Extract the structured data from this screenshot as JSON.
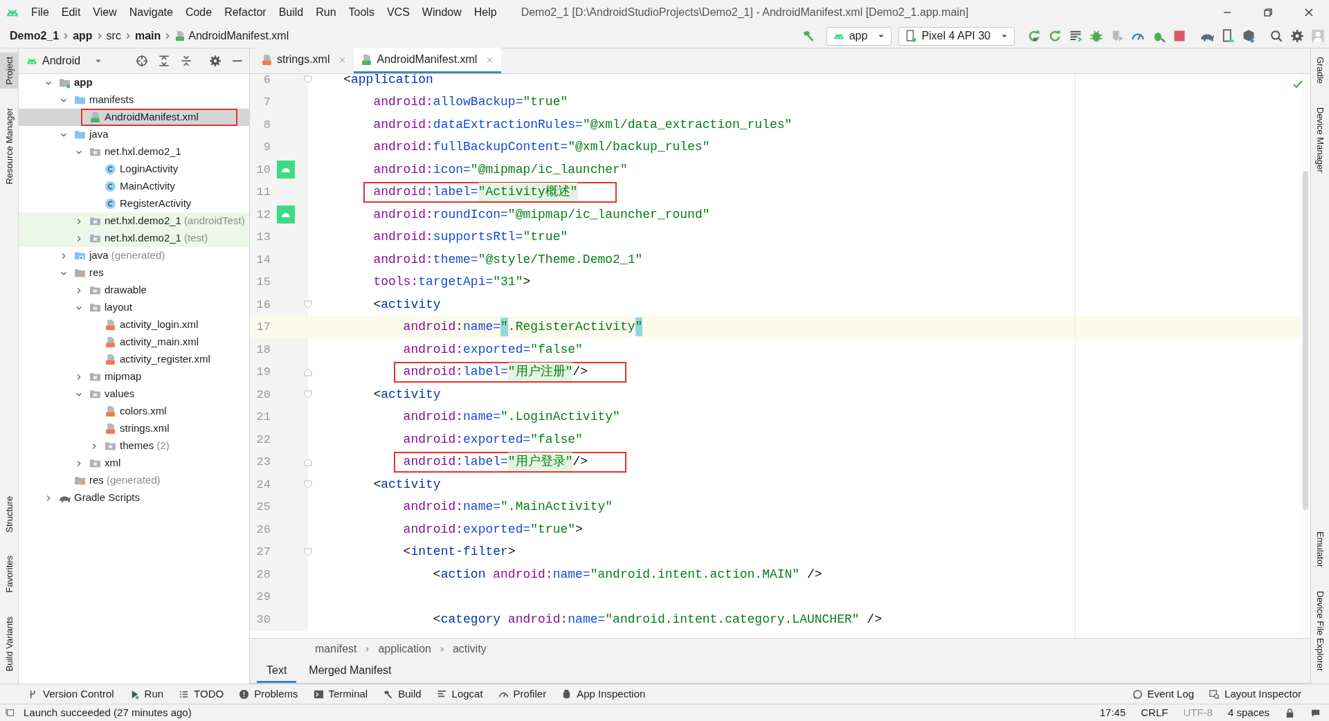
{
  "menu": [
    "File",
    "Edit",
    "View",
    "Navigate",
    "Code",
    "Refactor",
    "Build",
    "Run",
    "Tools",
    "VCS",
    "Window",
    "Help"
  ],
  "window_title": "Demo2_1 [D:\\AndroidStudioProjects\\Demo2_1] - AndroidManifest.xml [Demo2_1.app.main]",
  "breadcrumb": [
    {
      "text": "Demo2_1",
      "bold": true
    },
    {
      "text": "app",
      "bold": true
    },
    {
      "text": "src",
      "bold": false
    },
    {
      "text": "main",
      "bold": true
    },
    {
      "text": "AndroidManifest.xml",
      "bold": false
    }
  ],
  "run_config": "app",
  "device": "Pixel 4 API 30",
  "left_stripe": {
    "top": [
      {
        "label": "Project",
        "selected": true
      },
      {
        "label": "Resource Manager",
        "selected": false
      }
    ],
    "bottom": [
      {
        "label": "Structure",
        "selected": false
      },
      {
        "label": "Favorites",
        "selected": false
      },
      {
        "label": "Build Variants",
        "selected": false
      }
    ]
  },
  "right_stripe": {
    "top": [
      {
        "label": "Gradle",
        "selected": false
      },
      {
        "label": "Device Manager",
        "selected": false
      }
    ],
    "bottom": [
      {
        "label": "Emulator",
        "selected": false
      },
      {
        "label": "Device File Explorer",
        "selected": false
      }
    ]
  },
  "project_panel": {
    "view": "Android",
    "tree": [
      {
        "label": "app",
        "kind": "module",
        "bold": true,
        "selected": false,
        "highlighted": false,
        "boxed": false,
        "expanded": true,
        "children": [
          {
            "label": "manifests",
            "kind": "folder",
            "bold": false,
            "selected": false,
            "highlighted": false,
            "boxed": false,
            "expanded": true,
            "children": [
              {
                "label": "AndroidManifest.xml",
                "kind": "manifest",
                "bold": false,
                "selected": true,
                "highlighted": false,
                "boxed": true
              }
            ]
          },
          {
            "label": "java",
            "kind": "folder",
            "bold": false,
            "selected": false,
            "highlighted": false,
            "boxed": false,
            "expanded": true,
            "children": [
              {
                "label": "net.hxl.demo2_1",
                "kind": "package",
                "bold": false,
                "selected": false,
                "highlighted": false,
                "boxed": false,
                "expanded": true,
                "children": [
                  {
                    "label": "LoginActivity",
                    "kind": "class",
                    "bold": false,
                    "selected": false,
                    "highlighted": false,
                    "boxed": false
                  },
                  {
                    "label": "MainActivity",
                    "kind": "class",
                    "bold": false,
                    "selected": false,
                    "highlighted": false,
                    "boxed": false
                  },
                  {
                    "label": "RegisterActivity",
                    "kind": "class",
                    "bold": false,
                    "selected": false,
                    "highlighted": false,
                    "boxed": false
                  }
                ]
              },
              {
                "label": "net.hxl.demo2_1",
                "suffix": "(androidTest)",
                "kind": "package",
                "bold": false,
                "selected": false,
                "highlighted": true,
                "boxed": false,
                "expanded": false
              },
              {
                "label": "net.hxl.demo2_1",
                "suffix": "(test)",
                "kind": "package",
                "bold": false,
                "selected": false,
                "highlighted": true,
                "boxed": false,
                "expanded": false
              }
            ]
          },
          {
            "label": "java",
            "suffix": "(generated)",
            "kind": "generated",
            "bold": false,
            "selected": false,
            "highlighted": false,
            "boxed": false,
            "expanded": false
          },
          {
            "label": "res",
            "kind": "res",
            "bold": false,
            "selected": false,
            "highlighted": false,
            "boxed": false,
            "expanded": true,
            "children": [
              {
                "label": "drawable",
                "kind": "package",
                "bold": false,
                "selected": false,
                "highlighted": false,
                "boxed": false,
                "expanded": false
              },
              {
                "label": "layout",
                "kind": "package",
                "bold": false,
                "selected": false,
                "highlighted": false,
                "boxed": false,
                "expanded": true,
                "children": [
                  {
                    "label": "activity_login.xml",
                    "kind": "xml",
                    "bold": false,
                    "selected": false,
                    "highlighted": false,
                    "boxed": false
                  },
                  {
                    "label": "activity_main.xml",
                    "kind": "xml",
                    "bold": false,
                    "selected": false,
                    "highlighted": false,
                    "boxed": false
                  },
                  {
                    "label": "activity_register.xml",
                    "kind": "xml",
                    "bold": false,
                    "selected": false,
                    "highlighted": false,
                    "boxed": false
                  }
                ]
              },
              {
                "label": "mipmap",
                "kind": "package",
                "bold": false,
                "selected": false,
                "highlighted": false,
                "boxed": false,
                "expanded": false
              },
              {
                "label": "values",
                "kind": "package",
                "bold": false,
                "selected": false,
                "highlighted": false,
                "boxed": false,
                "expanded": true,
                "children": [
                  {
                    "label": "colors.xml",
                    "kind": "xml",
                    "bold": false,
                    "selected": false,
                    "highlighted": false,
                    "boxed": false
                  },
                  {
                    "label": "strings.xml",
                    "kind": "xml",
                    "bold": false,
                    "selected": false,
                    "highlighted": false,
                    "boxed": false
                  },
                  {
                    "label": "themes",
                    "suffix": "(2)",
                    "kind": "package",
                    "bold": false,
                    "selected": false,
                    "highlighted": false,
                    "boxed": false,
                    "expanded": false
                  }
                ]
              },
              {
                "label": "xml",
                "kind": "package",
                "bold": false,
                "selected": false,
                "highlighted": false,
                "boxed": false,
                "expanded": false
              }
            ]
          },
          {
            "label": "res",
            "suffix": "(generated)",
            "kind": "res",
            "bold": false,
            "selected": false,
            "highlighted": false,
            "boxed": false
          }
        ]
      },
      {
        "label": "Gradle Scripts",
        "kind": "gradle",
        "bold": false,
        "selected": false,
        "highlighted": false,
        "boxed": false,
        "expanded": false
      }
    ]
  },
  "editor_tabs": [
    {
      "label": "strings.xml",
      "kind": "xml",
      "selected": false
    },
    {
      "label": "AndroidManifest.xml",
      "kind": "manifest",
      "selected": true
    }
  ],
  "code_lines": [
    {
      "number": "6",
      "current": false,
      "boxed": false,
      "gutter_icon": false,
      "parts": [
        {
          "kind": "punct",
          "text": "<"
        },
        {
          "kind": "tag",
          "text": "application"
        }
      ],
      "children": [
        {
          "number": "7",
          "current": false,
          "boxed": false,
          "gutter_icon": false,
          "parts": [
            {
              "kind": "ns",
              "text": "android:"
            },
            {
              "kind": "attr",
              "text": "allowBackup="
            },
            {
              "kind": "value",
              "text": "\"true\""
            }
          ]
        },
        {
          "number": "8",
          "current": false,
          "boxed": false,
          "gutter_icon": false,
          "parts": [
            {
              "kind": "ns",
              "text": "android:"
            },
            {
              "kind": "attr",
              "text": "dataExtractionRules="
            },
            {
              "kind": "value",
              "text": "\"@xml/data_extraction_rules\""
            }
          ]
        },
        {
          "number": "9",
          "current": false,
          "boxed": false,
          "gutter_icon": false,
          "parts": [
            {
              "kind": "ns",
              "text": "android:"
            },
            {
              "kind": "attr",
              "text": "fullBackupContent="
            },
            {
              "kind": "value",
              "text": "\"@xml/backup_rules\""
            }
          ]
        },
        {
          "number": "10",
          "current": false,
          "boxed": false,
          "gutter_icon": true,
          "parts": [
            {
              "kind": "ns",
              "text": "android:"
            },
            {
              "kind": "attr",
              "text": "icon="
            },
            {
              "kind": "value",
              "text": "\"@mipmap/ic_launcher\""
            }
          ]
        },
        {
          "number": "11",
          "current": false,
          "boxed": true,
          "gutter_icon": false,
          "parts": [
            {
              "kind": "ns",
              "text": "android:"
            },
            {
              "kind": "attr",
              "text": "label="
            },
            {
              "kind": "value",
              "text": "\"Activity概述\"",
              "hl": true
            }
          ]
        },
        {
          "number": "12",
          "current": false,
          "boxed": false,
          "gutter_icon": true,
          "parts": [
            {
              "kind": "ns",
              "text": "android:"
            },
            {
              "kind": "attr",
              "text": "roundIcon="
            },
            {
              "kind": "value",
              "text": "\"@mipmap/ic_launcher_round\""
            }
          ]
        },
        {
          "number": "13",
          "current": false,
          "boxed": false,
          "gutter_icon": false,
          "parts": [
            {
              "kind": "ns",
              "text": "android:"
            },
            {
              "kind": "attr",
              "text": "supportsRtl="
            },
            {
              "kind": "value",
              "text": "\"true\""
            }
          ]
        },
        {
          "number": "14",
          "current": false,
          "boxed": false,
          "gutter_icon": false,
          "parts": [
            {
              "kind": "ns",
              "text": "android:"
            },
            {
              "kind": "attr",
              "text": "theme="
            },
            {
              "kind": "value",
              "text": "\"@style/Theme.Demo2_1\""
            }
          ]
        },
        {
          "number": "15",
          "current": false,
          "boxed": false,
          "gutter_icon": false,
          "parts": [
            {
              "kind": "ns",
              "text": "tools:"
            },
            {
              "kind": "attr",
              "text": "targetApi="
            },
            {
              "kind": "value",
              "text": "\"31\""
            },
            {
              "kind": "punct",
              "text": ">"
            }
          ]
        },
        {
          "number": "16",
          "current": false,
          "boxed": false,
          "gutter_icon": false,
          "closed": true,
          "parts": [
            {
              "kind": "punct",
              "text": "<"
            },
            {
              "kind": "tag",
              "text": "activity"
            }
          ],
          "children": [
            {
              "number": "17",
              "current": true,
              "boxed": false,
              "gutter_icon": false,
              "parts": [
                {
                  "kind": "ns",
                  "text": "android:"
                },
                {
                  "kind": "attr",
                  "text": "name="
                },
                {
                  "kind": "value",
                  "text": "\"",
                  "brace": true
                },
                {
                  "kind": "value",
                  "text": ".RegisterActivity"
                },
                {
                  "kind": "value",
                  "text": "\"",
                  "brace": true
                }
              ]
            },
            {
              "number": "18",
              "current": false,
              "boxed": false,
              "gutter_icon": false,
              "parts": [
                {
                  "kind": "ns",
                  "text": "android:"
                },
                {
                  "kind": "attr",
                  "text": "exported="
                },
                {
                  "kind": "value",
                  "text": "\"false\""
                }
              ]
            },
            {
              "number": "19",
              "current": false,
              "boxed": true,
              "gutter_icon": false,
              "parts": [
                {
                  "kind": "ns",
                  "text": "android:"
                },
                {
                  "kind": "attr",
                  "text": "label="
                },
                {
                  "kind": "value",
                  "text": "\"用户注册\"",
                  "hl": true
                },
                {
                  "kind": "punct",
                  "text": "/>"
                }
              ]
            }
          ]
        },
        {
          "number": "20",
          "current": false,
          "boxed": false,
          "gutter_icon": false,
          "closed": true,
          "parts": [
            {
              "kind": "punct",
              "text": "<"
            },
            {
              "kind": "tag",
              "text": "activity"
            }
          ],
          "children": [
            {
              "number": "21",
              "current": false,
              "boxed": false,
              "gutter_icon": false,
              "parts": [
                {
                  "kind": "ns",
                  "text": "android:"
                },
                {
                  "kind": "attr",
                  "text": "name="
                },
                {
                  "kind": "value",
                  "text": "\".LoginActivity\""
                }
              ]
            },
            {
              "number": "22",
              "current": false,
              "boxed": false,
              "gutter_icon": false,
              "parts": [
                {
                  "kind": "ns",
                  "text": "android:"
                },
                {
                  "kind": "attr",
                  "text": "exported="
                },
                {
                  "kind": "value",
                  "text": "\"false\""
                }
              ]
            },
            {
              "number": "23",
              "current": false,
              "boxed": true,
              "gutter_icon": false,
              "parts": [
                {
                  "kind": "ns",
                  "text": "android:"
                },
                {
                  "kind": "attr",
                  "text": "label="
                },
                {
                  "kind": "value",
                  "text": "\"用户登录\"",
                  "hl": true
                },
                {
                  "kind": "punct",
                  "text": "/>"
                }
              ]
            }
          ]
        },
        {
          "number": "24",
          "current": false,
          "boxed": false,
          "gutter_icon": false,
          "parts": [
            {
              "kind": "punct",
              "text": "<"
            },
            {
              "kind": "tag",
              "text": "activity"
            }
          ],
          "children": [
            {
              "number": "25",
              "current": false,
              "boxed": false,
              "gutter_icon": false,
              "parts": [
                {
                  "kind": "ns",
                  "text": "android:"
                },
                {
                  "kind": "attr",
                  "text": "name="
                },
                {
                  "kind": "value",
                  "text": "\".MainActivity\""
                }
              ]
            },
            {
              "number": "26",
              "current": false,
              "boxed": false,
              "gutter_icon": false,
              "parts": [
                {
                  "kind": "ns",
                  "text": "android:"
                },
                {
                  "kind": "attr",
                  "text": "exported="
                },
                {
                  "kind": "value",
                  "text": "\"true\""
                },
                {
                  "kind": "punct",
                  "text": ">"
                }
              ]
            },
            {
              "number": "27",
              "current": false,
              "boxed": false,
              "gutter_icon": false,
              "closed": false,
              "parts": [
                {
                  "kind": "punct",
                  "text": "<"
                },
                {
                  "kind": "tag",
                  "text": "intent-filter"
                },
                {
                  "kind": "punct",
                  "text": ">"
                }
              ],
              "children": [
                {
                  "number": "28",
                  "current": false,
                  "boxed": false,
                  "gutter_icon": false,
                  "parts": [
                    {
                      "kind": "punct",
                      "text": "<"
                    },
                    {
                      "kind": "tag",
                      "text": "action "
                    },
                    {
                      "kind": "ns",
                      "text": "android:"
                    },
                    {
                      "kind": "attr",
                      "text": "name="
                    },
                    {
                      "kind": "value",
                      "text": "\"android.intent.action.MAIN\""
                    },
                    {
                      "kind": "punct",
                      "text": " />"
                    }
                  ]
                },
                {
                  "number": "29",
                  "current": false,
                  "boxed": false,
                  "gutter_icon": false
                },
                {
                  "number": "30",
                  "current": false,
                  "boxed": false,
                  "gutter_icon": false,
                  "parts": [
                    {
                      "kind": "punct",
                      "text": "<"
                    },
                    {
                      "kind": "tag",
                      "text": "category "
                    },
                    {
                      "kind": "ns",
                      "text": "android:"
                    },
                    {
                      "kind": "attr",
                      "text": "name="
                    },
                    {
                      "kind": "value",
                      "text": "\"android.intent.category.LAUNCHER\""
                    },
                    {
                      "kind": "punct",
                      "text": " />"
                    }
                  ]
                }
              ]
            }
          ]
        }
      ]
    }
  ],
  "editor_breadcrumb": [
    "manifest",
    "application",
    "activity"
  ],
  "editor_mode_tabs": [
    {
      "label": "Text",
      "selected": true
    },
    {
      "label": "Merged Manifest",
      "selected": false
    }
  ],
  "tool_windows_left": [
    "Version Control",
    "Run",
    "TODO",
    "Problems",
    "Terminal",
    "Build",
    "Logcat",
    "Profiler",
    "App Inspection"
  ],
  "tool_windows_right": [
    "Event Log",
    "Layout Inspector"
  ],
  "status": {
    "message": "Launch succeeded (27 minutes ago)",
    "items": [
      {
        "text": "17:45",
        "dim": false
      },
      {
        "text": "CRLF",
        "dim": false
      },
      {
        "text": "UTF-8",
        "dim": true
      },
      {
        "text": "4 spaces",
        "dim": false
      }
    ]
  }
}
